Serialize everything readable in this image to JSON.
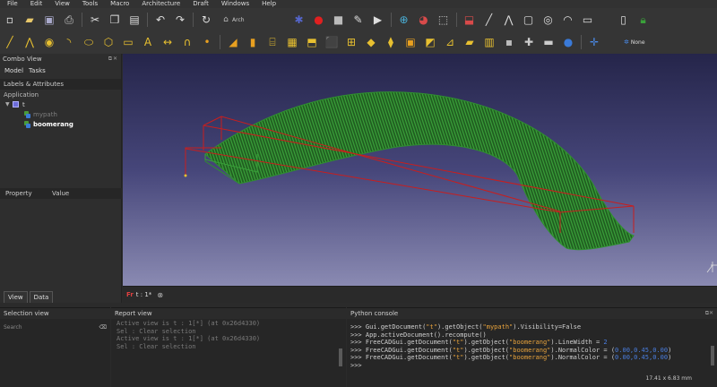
{
  "menu": [
    "File",
    "Edit",
    "View",
    "Tools",
    "Macro",
    "Architecture",
    "Draft",
    "Windows",
    "Help"
  ],
  "toolbar1": {
    "workbench": "Arch",
    "icons": [
      "new-document-icon",
      "open-document-icon",
      "save-icon",
      "print-icon",
      "cut-icon",
      "copy-icon",
      "paste-icon",
      "undo-icon",
      "redo-icon",
      "refresh-icon",
      "workbench-icon",
      "macro-icon",
      "record-macro-icon",
      "stop-macro-icon",
      "edit-macro-icon",
      "run-macro-icon",
      "fit-all-icon",
      "draw-style-icon",
      "bounding-box-icon",
      "measure-icon",
      "polyline-icon",
      "rectangle-icon",
      "circle-icon",
      "arc-icon",
      "box-icon",
      "part-icon"
    ]
  },
  "toolbar2": {
    "snap_mode": "None",
    "icons": [
      "line-icon",
      "wire-icon",
      "circle-draw-icon",
      "arc-draw-icon",
      "ellipse-icon",
      "polygon-icon",
      "rectangle-draw-icon",
      "text-icon",
      "dimension-icon",
      "point-icon",
      "wall-icon",
      "structure-icon",
      "rebar-icon",
      "floor-icon",
      "building-icon",
      "site-icon",
      "window-icon",
      "roof-icon",
      "axis-icon",
      "section-icon",
      "space-icon",
      "stairs-icon",
      "panel-icon",
      "equipment-icon",
      "add-icon",
      "remove-icon",
      "sphere-icon",
      "snap-icon"
    ]
  },
  "combo_view": {
    "title": "Combo View",
    "tabs": [
      "Model",
      "Tasks"
    ],
    "labels_header": "Labels & Attributes",
    "application": "Application",
    "document": "t",
    "objects": [
      {
        "name": "mypath",
        "visible": false
      },
      {
        "name": "boomerang",
        "visible": true
      }
    ],
    "property_header": [
      "Property",
      "Value"
    ],
    "bottom_tabs": [
      "View",
      "Data"
    ]
  },
  "document_tab": {
    "label": "t : 1*"
  },
  "selection_view": {
    "title": "Selection view",
    "search_placeholder": "Search"
  },
  "report_view": {
    "title": "Report view",
    "lines": [
      "Active view is t : 1[*] (at 0x26d4330)",
      "Sel : Clear selection",
      "Active view is t : 1[*] (at 0x26d4330)",
      "Sel : Clear selection"
    ]
  },
  "python_console": {
    "title": "Python console",
    "lines": [
      [
        [
          ">>> ",
          "prompt"
        ],
        [
          "Gui.getDocument(",
          "plain"
        ],
        [
          "\"t\"",
          "str"
        ],
        [
          ").getObject(",
          "plain"
        ],
        [
          "\"mypath\"",
          "str"
        ],
        [
          ").Visibility=False",
          "plain"
        ]
      ],
      [
        [
          ">>> ",
          "prompt"
        ],
        [
          "App.activeDocument().recompute()",
          "plain"
        ]
      ],
      [
        [
          ">>> ",
          "prompt"
        ],
        [
          "FreeCADGui.getDocument(",
          "plain"
        ],
        [
          "\"t\"",
          "str"
        ],
        [
          ").getObject(",
          "plain"
        ],
        [
          "\"boomerang\"",
          "str"
        ],
        [
          ").LineWidth = ",
          "plain"
        ],
        [
          "2",
          "num"
        ]
      ],
      [
        [
          ">>> ",
          "prompt"
        ],
        [
          "FreeCADGui.getDocument(",
          "plain"
        ],
        [
          "\"t\"",
          "str"
        ],
        [
          ").getObject(",
          "plain"
        ],
        [
          "\"boomerang\"",
          "str"
        ],
        [
          ").NormalColor = (",
          "plain"
        ],
        [
          "0.00,0.45,0.00",
          "num"
        ],
        [
          ")",
          "plain"
        ]
      ],
      [
        [
          ">>> ",
          "prompt"
        ],
        [
          "FreeCADGui.getDocument(",
          "plain"
        ],
        [
          "\"t\"",
          "str"
        ],
        [
          ").getObject(",
          "plain"
        ],
        [
          "\"boomerang\"",
          "str"
        ],
        [
          ").NormalColor = (",
          "plain"
        ],
        [
          "0.00,0.45,0.00",
          "num"
        ],
        [
          ")",
          "plain"
        ]
      ],
      [
        [
          ">>> ",
          "prompt"
        ]
      ]
    ]
  },
  "status": {
    "dimensions": "17.41 x 6.83 mm"
  },
  "colors": {
    "sweep_green": "#2f8f2f",
    "path_red": "#c81e1e",
    "viewport_top": "#25254a",
    "viewport_bottom": "#8a8ab2",
    "string_orange": "#e8a33c",
    "number_blue": "#4a7ee0"
  }
}
